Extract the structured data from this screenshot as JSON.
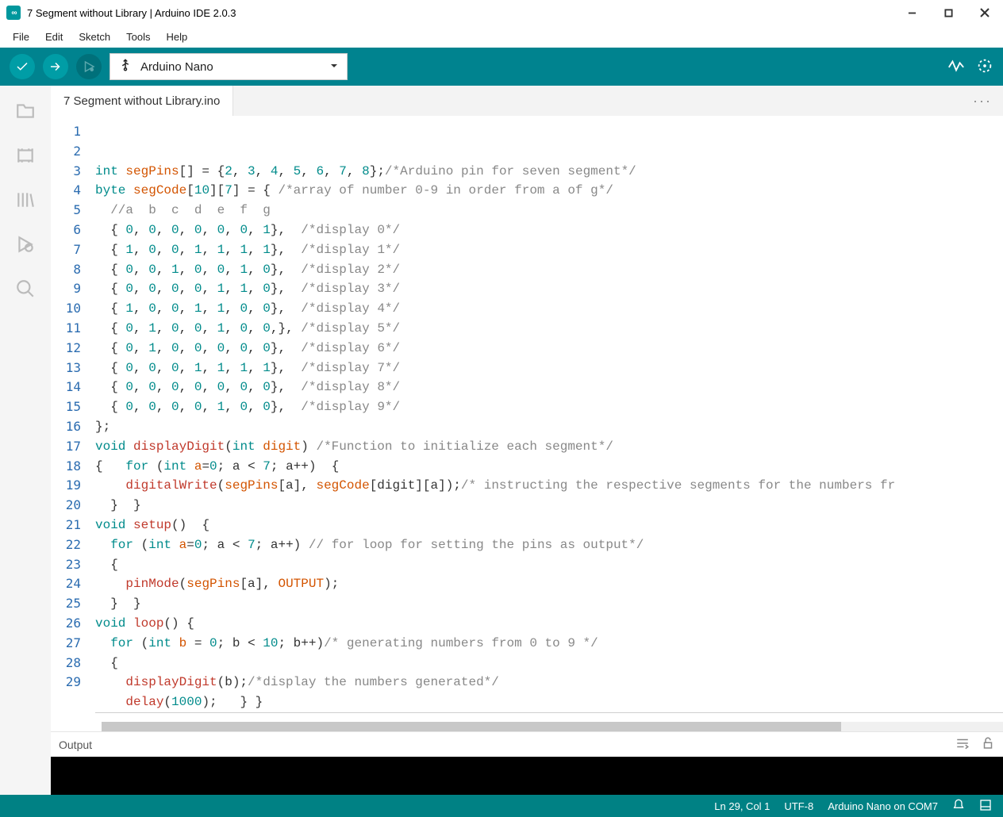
{
  "window": {
    "title": "7 Segment without Library | Arduino IDE 2.0.3"
  },
  "menu": [
    "File",
    "Edit",
    "Sketch",
    "Tools",
    "Help"
  ],
  "board": {
    "name": "Arduino Nano"
  },
  "tab": {
    "name": "7 Segment without Library.ino"
  },
  "status": {
    "pos": "Ln 29, Col 1",
    "enc": "UTF-8",
    "port": "Arduino Nano on COM7"
  },
  "output": {
    "label": "Output"
  },
  "code": {
    "lines": [
      [
        [
          "kw",
          "int "
        ],
        [
          "var",
          "segPins"
        ],
        [
          "plain",
          "[] = {"
        ],
        [
          "num",
          "2"
        ],
        [
          "plain",
          ", "
        ],
        [
          "num",
          "3"
        ],
        [
          "plain",
          ", "
        ],
        [
          "num",
          "4"
        ],
        [
          "plain",
          ", "
        ],
        [
          "num",
          "5"
        ],
        [
          "plain",
          ", "
        ],
        [
          "num",
          "6"
        ],
        [
          "plain",
          ", "
        ],
        [
          "num",
          "7"
        ],
        [
          "plain",
          ", "
        ],
        [
          "num",
          "8"
        ],
        [
          "plain",
          "};"
        ],
        [
          "com",
          "/*Arduino pin for seven segment*/"
        ]
      ],
      [
        [
          "kw",
          "byte "
        ],
        [
          "var",
          "segCode"
        ],
        [
          "plain",
          "["
        ],
        [
          "num",
          "10"
        ],
        [
          "plain",
          "]["
        ],
        [
          "num",
          "7"
        ],
        [
          "plain",
          "] = { "
        ],
        [
          "com",
          "/*array of number 0-9 in order from a of g*/"
        ]
      ],
      [
        [
          "plain",
          "  "
        ],
        [
          "com",
          "//a  b  c  d  e  f  g"
        ]
      ],
      [
        [
          "plain",
          "  { "
        ],
        [
          "num",
          "0"
        ],
        [
          "plain",
          ", "
        ],
        [
          "num",
          "0"
        ],
        [
          "plain",
          ", "
        ],
        [
          "num",
          "0"
        ],
        [
          "plain",
          ", "
        ],
        [
          "num",
          "0"
        ],
        [
          "plain",
          ", "
        ],
        [
          "num",
          "0"
        ],
        [
          "plain",
          ", "
        ],
        [
          "num",
          "0"
        ],
        [
          "plain",
          ", "
        ],
        [
          "num",
          "1"
        ],
        [
          "plain",
          "},  "
        ],
        [
          "com",
          "/*display 0*/"
        ]
      ],
      [
        [
          "plain",
          "  { "
        ],
        [
          "num",
          "1"
        ],
        [
          "plain",
          ", "
        ],
        [
          "num",
          "0"
        ],
        [
          "plain",
          ", "
        ],
        [
          "num",
          "0"
        ],
        [
          "plain",
          ", "
        ],
        [
          "num",
          "1"
        ],
        [
          "plain",
          ", "
        ],
        [
          "num",
          "1"
        ],
        [
          "plain",
          ", "
        ],
        [
          "num",
          "1"
        ],
        [
          "plain",
          ", "
        ],
        [
          "num",
          "1"
        ],
        [
          "plain",
          "},  "
        ],
        [
          "com",
          "/*display 1*/"
        ]
      ],
      [
        [
          "plain",
          "  { "
        ],
        [
          "num",
          "0"
        ],
        [
          "plain",
          ", "
        ],
        [
          "num",
          "0"
        ],
        [
          "plain",
          ", "
        ],
        [
          "num",
          "1"
        ],
        [
          "plain",
          ", "
        ],
        [
          "num",
          "0"
        ],
        [
          "plain",
          ", "
        ],
        [
          "num",
          "0"
        ],
        [
          "plain",
          ", "
        ],
        [
          "num",
          "1"
        ],
        [
          "plain",
          ", "
        ],
        [
          "num",
          "0"
        ],
        [
          "plain",
          "},  "
        ],
        [
          "com",
          "/*display 2*/"
        ]
      ],
      [
        [
          "plain",
          "  { "
        ],
        [
          "num",
          "0"
        ],
        [
          "plain",
          ", "
        ],
        [
          "num",
          "0"
        ],
        [
          "plain",
          ", "
        ],
        [
          "num",
          "0"
        ],
        [
          "plain",
          ", "
        ],
        [
          "num",
          "0"
        ],
        [
          "plain",
          ", "
        ],
        [
          "num",
          "1"
        ],
        [
          "plain",
          ", "
        ],
        [
          "num",
          "1"
        ],
        [
          "plain",
          ", "
        ],
        [
          "num",
          "0"
        ],
        [
          "plain",
          "},  "
        ],
        [
          "com",
          "/*display 3*/"
        ]
      ],
      [
        [
          "plain",
          "  { "
        ],
        [
          "num",
          "1"
        ],
        [
          "plain",
          ", "
        ],
        [
          "num",
          "0"
        ],
        [
          "plain",
          ", "
        ],
        [
          "num",
          "0"
        ],
        [
          "plain",
          ", "
        ],
        [
          "num",
          "1"
        ],
        [
          "plain",
          ", "
        ],
        [
          "num",
          "1"
        ],
        [
          "plain",
          ", "
        ],
        [
          "num",
          "0"
        ],
        [
          "plain",
          ", "
        ],
        [
          "num",
          "0"
        ],
        [
          "plain",
          "},  "
        ],
        [
          "com",
          "/*display 4*/"
        ]
      ],
      [
        [
          "plain",
          "  { "
        ],
        [
          "num",
          "0"
        ],
        [
          "plain",
          ", "
        ],
        [
          "num",
          "1"
        ],
        [
          "plain",
          ", "
        ],
        [
          "num",
          "0"
        ],
        [
          "plain",
          ", "
        ],
        [
          "num",
          "0"
        ],
        [
          "plain",
          ", "
        ],
        [
          "num",
          "1"
        ],
        [
          "plain",
          ", "
        ],
        [
          "num",
          "0"
        ],
        [
          "plain",
          ", "
        ],
        [
          "num",
          "0"
        ],
        [
          "plain",
          ",}, "
        ],
        [
          "com",
          "/*display 5*/"
        ]
      ],
      [
        [
          "plain",
          "  { "
        ],
        [
          "num",
          "0"
        ],
        [
          "plain",
          ", "
        ],
        [
          "num",
          "1"
        ],
        [
          "plain",
          ", "
        ],
        [
          "num",
          "0"
        ],
        [
          "plain",
          ", "
        ],
        [
          "num",
          "0"
        ],
        [
          "plain",
          ", "
        ],
        [
          "num",
          "0"
        ],
        [
          "plain",
          ", "
        ],
        [
          "num",
          "0"
        ],
        [
          "plain",
          ", "
        ],
        [
          "num",
          "0"
        ],
        [
          "plain",
          "},  "
        ],
        [
          "com",
          "/*display 6*/"
        ]
      ],
      [
        [
          "plain",
          "  { "
        ],
        [
          "num",
          "0"
        ],
        [
          "plain",
          ", "
        ],
        [
          "num",
          "0"
        ],
        [
          "plain",
          ", "
        ],
        [
          "num",
          "0"
        ],
        [
          "plain",
          ", "
        ],
        [
          "num",
          "1"
        ],
        [
          "plain",
          ", "
        ],
        [
          "num",
          "1"
        ],
        [
          "plain",
          ", "
        ],
        [
          "num",
          "1"
        ],
        [
          "plain",
          ", "
        ],
        [
          "num",
          "1"
        ],
        [
          "plain",
          "},  "
        ],
        [
          "com",
          "/*display 7*/"
        ]
      ],
      [
        [
          "plain",
          "  { "
        ],
        [
          "num",
          "0"
        ],
        [
          "plain",
          ", "
        ],
        [
          "num",
          "0"
        ],
        [
          "plain",
          ", "
        ],
        [
          "num",
          "0"
        ],
        [
          "plain",
          ", "
        ],
        [
          "num",
          "0"
        ],
        [
          "plain",
          ", "
        ],
        [
          "num",
          "0"
        ],
        [
          "plain",
          ", "
        ],
        [
          "num",
          "0"
        ],
        [
          "plain",
          ", "
        ],
        [
          "num",
          "0"
        ],
        [
          "plain",
          "},  "
        ],
        [
          "com",
          "/*display 8*/"
        ]
      ],
      [
        [
          "plain",
          "  { "
        ],
        [
          "num",
          "0"
        ],
        [
          "plain",
          ", "
        ],
        [
          "num",
          "0"
        ],
        [
          "plain",
          ", "
        ],
        [
          "num",
          "0"
        ],
        [
          "plain",
          ", "
        ],
        [
          "num",
          "0"
        ],
        [
          "plain",
          ", "
        ],
        [
          "num",
          "1"
        ],
        [
          "plain",
          ", "
        ],
        [
          "num",
          "0"
        ],
        [
          "plain",
          ", "
        ],
        [
          "num",
          "0"
        ],
        [
          "plain",
          "},  "
        ],
        [
          "com",
          "/*display 9*/"
        ]
      ],
      [
        [
          "plain",
          "};"
        ]
      ],
      [
        [
          "kw",
          "void "
        ],
        [
          "fn",
          "displayDigit"
        ],
        [
          "plain",
          "("
        ],
        [
          "kw",
          "int "
        ],
        [
          "var",
          "digit"
        ],
        [
          "plain",
          ") "
        ],
        [
          "com",
          "/*Function to initialize each segment*/"
        ]
      ],
      [
        [
          "plain",
          "{   "
        ],
        [
          "kw",
          "for "
        ],
        [
          "plain",
          "("
        ],
        [
          "kw",
          "int "
        ],
        [
          "var",
          "a"
        ],
        [
          "plain",
          "="
        ],
        [
          "num",
          "0"
        ],
        [
          "plain",
          "; a < "
        ],
        [
          "num",
          "7"
        ],
        [
          "plain",
          "; a++)  {"
        ]
      ],
      [
        [
          "plain",
          "    "
        ],
        [
          "fn",
          "digitalWrite"
        ],
        [
          "plain",
          "("
        ],
        [
          "var",
          "segPins"
        ],
        [
          "plain",
          "[a], "
        ],
        [
          "var",
          "segCode"
        ],
        [
          "plain",
          "[digit][a]);"
        ],
        [
          "com",
          "/* instructing the respective segments for the numbers fr"
        ]
      ],
      [
        [
          "plain",
          "  }  }"
        ]
      ],
      [
        [
          "kw",
          "void "
        ],
        [
          "fn",
          "setup"
        ],
        [
          "plain",
          "()  {"
        ]
      ],
      [
        [
          "plain",
          "  "
        ],
        [
          "kw",
          "for "
        ],
        [
          "plain",
          "("
        ],
        [
          "kw",
          "int "
        ],
        [
          "var",
          "a"
        ],
        [
          "plain",
          "="
        ],
        [
          "num",
          "0"
        ],
        [
          "plain",
          "; a < "
        ],
        [
          "num",
          "7"
        ],
        [
          "plain",
          "; a++) "
        ],
        [
          "com",
          "// for loop for setting the pins as output*/"
        ]
      ],
      [
        [
          "plain",
          "  {"
        ]
      ],
      [
        [
          "plain",
          "    "
        ],
        [
          "fn",
          "pinMode"
        ],
        [
          "plain",
          "("
        ],
        [
          "var",
          "segPins"
        ],
        [
          "plain",
          "[a], "
        ],
        [
          "var",
          "OUTPUT"
        ],
        [
          "plain",
          ");"
        ]
      ],
      [
        [
          "plain",
          "  }  }"
        ]
      ],
      [
        [
          "kw",
          "void "
        ],
        [
          "fn",
          "loop"
        ],
        [
          "plain",
          "() {"
        ]
      ],
      [
        [
          "plain",
          "  "
        ],
        [
          "kw",
          "for "
        ],
        [
          "plain",
          "("
        ],
        [
          "kw",
          "int "
        ],
        [
          "var",
          "b"
        ],
        [
          "plain",
          " = "
        ],
        [
          "num",
          "0"
        ],
        [
          "plain",
          "; b < "
        ],
        [
          "num",
          "10"
        ],
        [
          "plain",
          "; b++)"
        ],
        [
          "com",
          "/* generating numbers from 0 to 9 */"
        ]
      ],
      [
        [
          "plain",
          "  {"
        ]
      ],
      [
        [
          "plain",
          "    "
        ],
        [
          "fn",
          "displayDigit"
        ],
        [
          "plain",
          "(b);"
        ],
        [
          "com",
          "/*display the numbers generated*/"
        ]
      ],
      [
        [
          "plain",
          "    "
        ],
        [
          "fn",
          "delay"
        ],
        [
          "plain",
          "("
        ],
        [
          "num",
          "1000"
        ],
        [
          "plain",
          ");   } }"
        ]
      ],
      [
        [
          "plain",
          ""
        ]
      ]
    ]
  }
}
